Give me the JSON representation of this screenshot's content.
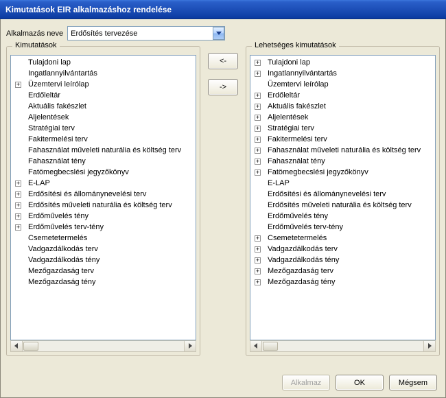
{
  "window": {
    "title": "Kimutatások EIR alkalmazáshoz rendelése"
  },
  "app_select": {
    "label": "Alkalmazás neve",
    "value": "Erdősítés tervezése"
  },
  "left_group": {
    "title": "Kimutatások"
  },
  "right_group": {
    "title": "Lehetséges kimutatások"
  },
  "buttons": {
    "move_left": "<-",
    "move_right": "->",
    "apply": "Alkalmaz",
    "ok": "OK",
    "cancel": "Mégsem"
  },
  "left_tree": [
    {
      "label": "Tulajdoni lap",
      "expandable": false
    },
    {
      "label": "Ingatlannyilvántartás",
      "expandable": false
    },
    {
      "label": "Üzemtervi leírólap",
      "expandable": true
    },
    {
      "label": "Erdőleltár",
      "expandable": false
    },
    {
      "label": "Aktuális fakészlet",
      "expandable": false
    },
    {
      "label": "Aljelentések",
      "expandable": false
    },
    {
      "label": "Stratégiai terv",
      "expandable": false
    },
    {
      "label": "Fakitermelési terv",
      "expandable": false
    },
    {
      "label": "Fahasználat műveleti naturália és költség terv",
      "expandable": false
    },
    {
      "label": "Fahasználat tény",
      "expandable": false
    },
    {
      "label": "Fatömegbecslési jegyzőkönyv",
      "expandable": false
    },
    {
      "label": "E-LAP",
      "expandable": true
    },
    {
      "label": "Erdősítési és állománynevelési terv",
      "expandable": true
    },
    {
      "label": "Erdősítés műveleti naturália és költség terv",
      "expandable": true
    },
    {
      "label": "Erdőművelés tény",
      "expandable": true
    },
    {
      "label": "Erdőművelés terv-tény",
      "expandable": true
    },
    {
      "label": "Csemetetermelés",
      "expandable": false
    },
    {
      "label": "Vadgazdálkodás terv",
      "expandable": false
    },
    {
      "label": "Vadgazdálkodás tény",
      "expandable": false
    },
    {
      "label": "Mezőgazdaság terv",
      "expandable": false
    },
    {
      "label": "Mezőgazdaság tény",
      "expandable": false
    }
  ],
  "right_tree": [
    {
      "label": "Tulajdoni lap",
      "expandable": true
    },
    {
      "label": "Ingatlannyilvántartás",
      "expandable": true
    },
    {
      "label": "Üzemtervi leírólap",
      "expandable": false
    },
    {
      "label": "Erdőleltár",
      "expandable": true
    },
    {
      "label": "Aktuális fakészlet",
      "expandable": true
    },
    {
      "label": "Aljelentések",
      "expandable": true
    },
    {
      "label": "Stratégiai terv",
      "expandable": true
    },
    {
      "label": "Fakitermelési terv",
      "expandable": true
    },
    {
      "label": "Fahasználat műveleti naturália és költség terv",
      "expandable": true
    },
    {
      "label": "Fahasználat tény",
      "expandable": true
    },
    {
      "label": "Fatömegbecslési jegyzőkönyv",
      "expandable": true
    },
    {
      "label": "E-LAP",
      "expandable": false
    },
    {
      "label": "Erdősítési és állománynevelési terv",
      "expandable": false
    },
    {
      "label": "Erdősítés műveleti naturália és költség terv",
      "expandable": false
    },
    {
      "label": "Erdőművelés tény",
      "expandable": false
    },
    {
      "label": "Erdőművelés terv-tény",
      "expandable": false
    },
    {
      "label": "Csemetetermelés",
      "expandable": true
    },
    {
      "label": "Vadgazdálkodás terv",
      "expandable": true
    },
    {
      "label": "Vadgazdálkodás tény",
      "expandable": true
    },
    {
      "label": "Mezőgazdaság terv",
      "expandable": true
    },
    {
      "label": "Mezőgazdaság tény",
      "expandable": true
    }
  ]
}
